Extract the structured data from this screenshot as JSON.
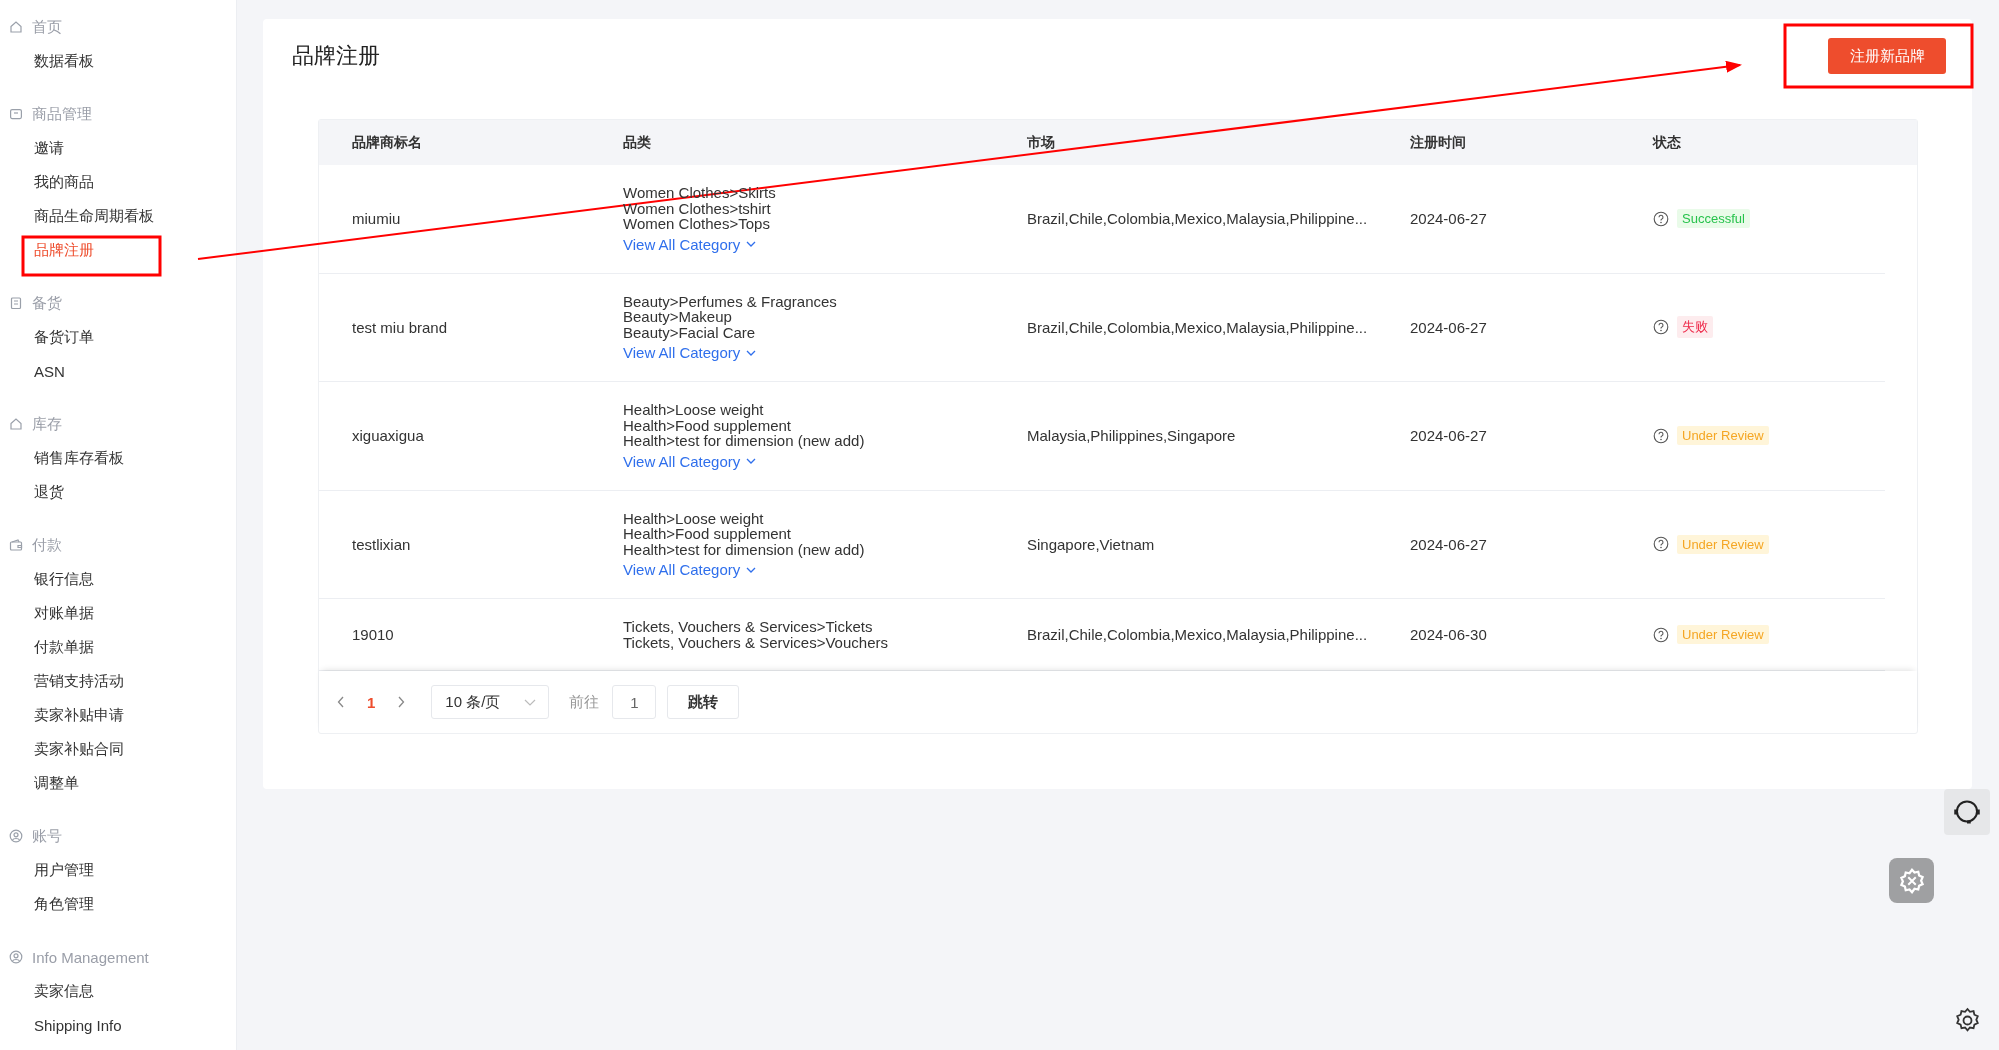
{
  "sidebar": {
    "groups": [
      {
        "title": "首页",
        "items": [
          {
            "label": "数据看板",
            "selected": false
          }
        ]
      },
      {
        "title": "商品管理",
        "items": [
          {
            "label": "邀请",
            "selected": false
          },
          {
            "label": "我的商品",
            "selected": false
          },
          {
            "label": "商品生命周期看板",
            "selected": false
          },
          {
            "label": "品牌注册",
            "selected": true
          }
        ]
      },
      {
        "title": "备货",
        "items": [
          {
            "label": "备货订单",
            "selected": false
          },
          {
            "label": "ASN",
            "selected": false
          }
        ]
      },
      {
        "title": "库存",
        "items": [
          {
            "label": "销售库存看板",
            "selected": false
          },
          {
            "label": "退货",
            "selected": false
          }
        ]
      },
      {
        "title": "付款",
        "items": [
          {
            "label": "银行信息",
            "selected": false
          },
          {
            "label": "对账单据",
            "selected": false
          },
          {
            "label": "付款单据",
            "selected": false
          },
          {
            "label": "营销支持活动",
            "selected": false
          },
          {
            "label": "卖家补贴申请",
            "selected": false
          },
          {
            "label": "卖家补贴合同",
            "selected": false
          },
          {
            "label": "调整单",
            "selected": false
          }
        ]
      },
      {
        "title": "账号",
        "items": [
          {
            "label": "用户管理",
            "selected": false
          },
          {
            "label": "角色管理",
            "selected": false
          }
        ]
      },
      {
        "title": "Info Management",
        "items": [
          {
            "label": "卖家信息",
            "selected": false
          },
          {
            "label": "Shipping Info",
            "selected": false
          }
        ]
      }
    ]
  },
  "page": {
    "title": "品牌注册",
    "primary_button": "注册新品牌"
  },
  "table": {
    "columns": [
      "品牌商标名",
      "品类",
      "市场",
      "注册时间",
      "状态"
    ],
    "rows": [
      {
        "name": "miumiu",
        "categories": [
          "Women Clothes>Skirts",
          "Women Clothes>tshirt",
          "Women Clothes>Tops"
        ],
        "view_all": "View All Category",
        "market": "Brazil,Chile,Colombia,Mexico,Malaysia,Philippine...",
        "date": "2024-06-27",
        "status": {
          "kind": "success",
          "label": "Successful"
        }
      },
      {
        "name": "test miu brand",
        "categories": [
          "Beauty>Perfumes & Fragrances",
          "Beauty>Makeup",
          "Beauty>Facial Care"
        ],
        "view_all": "View All Category",
        "market": "Brazil,Chile,Colombia,Mexico,Malaysia,Philippine...",
        "date": "2024-06-27",
        "status": {
          "kind": "fail",
          "label": "失败"
        }
      },
      {
        "name": "xiguaxigua",
        "categories": [
          "Health>Loose weight",
          "Health>Food supplement",
          "Health>test for dimension (new add)"
        ],
        "view_all": "View All Category",
        "market": "Malaysia,Philippines,Singapore",
        "date": "2024-06-27",
        "status": {
          "kind": "review",
          "label": "Under Review"
        }
      },
      {
        "name": "testlixian",
        "categories": [
          "Health>Loose weight",
          "Health>Food supplement",
          "Health>test for dimension (new add)"
        ],
        "view_all": "View All Category",
        "market": "Singapore,Vietnam",
        "date": "2024-06-27",
        "status": {
          "kind": "review",
          "label": "Under Review"
        }
      },
      {
        "name": "19010",
        "categories": [
          "Tickets, Vouchers & Services>Tickets",
          "Tickets, Vouchers & Services>Vouchers"
        ],
        "market": "Brazil,Chile,Colombia,Mexico,Malaysia,Philippine...",
        "date": "2024-06-30",
        "status": {
          "kind": "review",
          "label": "Under Review"
        }
      }
    ]
  },
  "pagination": {
    "pages": [
      {
        "label": "1",
        "selected": true
      }
    ],
    "page_size": "10 条/页",
    "goto_label": "前往",
    "goto_value": "1",
    "goto_button": "跳转"
  }
}
